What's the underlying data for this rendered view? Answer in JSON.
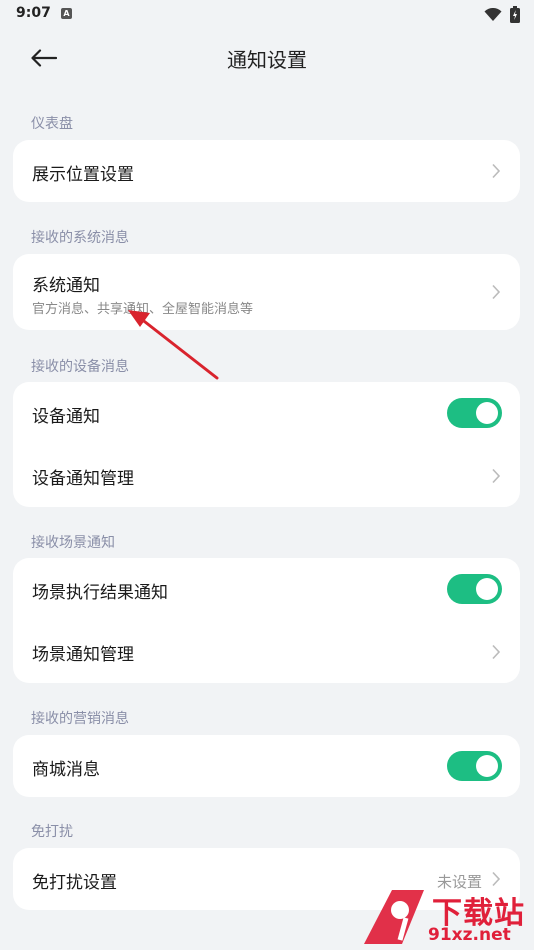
{
  "status_bar": {
    "time": "9:07",
    "notif_letter": "A"
  },
  "header": {
    "title": "通知设置"
  },
  "sections": [
    {
      "header": "仪表盘"
    },
    {
      "header": "接收的系统消息"
    },
    {
      "header": "接收的设备消息"
    },
    {
      "header": "接收场景通知"
    },
    {
      "header": "接收的营销消息"
    },
    {
      "header": "免打扰"
    }
  ],
  "items": {
    "display_position": {
      "label": "展示位置设置"
    },
    "system_notice": {
      "label": "系统通知",
      "subtitle": "官方消息、共享通知、全屋智能消息等"
    },
    "device_notice": {
      "label": "设备通知",
      "enabled": true
    },
    "device_notice_manage": {
      "label": "设备通知管理"
    },
    "scene_result_notice": {
      "label": "场景执行结果通知",
      "enabled": true
    },
    "scene_notice_manage": {
      "label": "场景通知管理"
    },
    "mall_message": {
      "label": "商城消息",
      "enabled": true
    },
    "dnd_settings": {
      "label": "免打扰设置",
      "value": "未设置"
    }
  },
  "watermark": {
    "top": "下载站",
    "bottom": "91xz.net"
  },
  "colors": {
    "accent": "#1dbe83",
    "arrow": "#d9232d",
    "background": "#f1f3f5",
    "section_header": "#8a8fa8"
  }
}
